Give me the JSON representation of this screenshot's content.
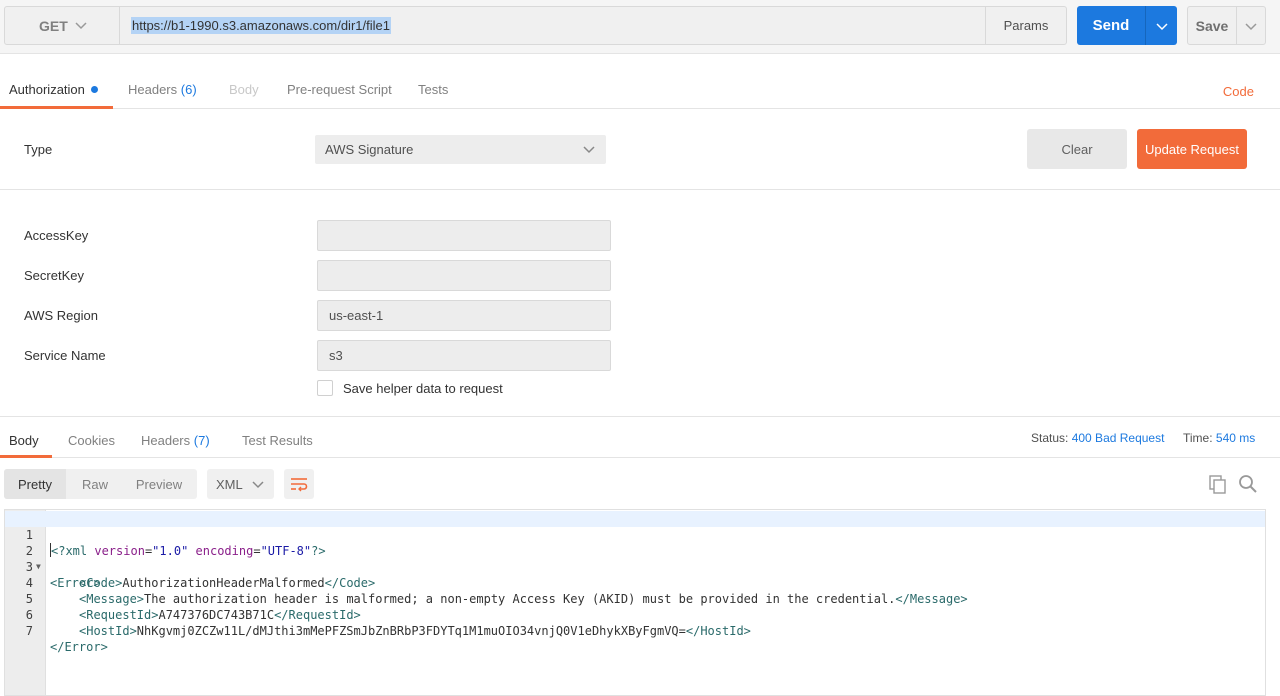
{
  "request": {
    "method": "GET",
    "url": "https://b1-1990.s3.amazonaws.com/dir1/file1",
    "params_label": "Params",
    "send_label": "Send",
    "save_label": "Save"
  },
  "request_tabs": {
    "authorization": "Authorization",
    "headers": "Headers",
    "headers_count": "(6)",
    "body": "Body",
    "prerequest": "Pre-request Script",
    "tests": "Tests",
    "code": "Code"
  },
  "auth": {
    "type_label": "Type",
    "type_value": "AWS Signature",
    "clear_label": "Clear",
    "update_label": "Update Request",
    "fields": [
      {
        "label": "AccessKey",
        "value": ""
      },
      {
        "label": "SecretKey",
        "value": ""
      },
      {
        "label": "AWS Region",
        "value": "us-east-1"
      },
      {
        "label": "Service Name",
        "value": "s3"
      }
    ],
    "save_helper_label": "Save helper data to request",
    "save_helper_checked": false
  },
  "response_tabs": {
    "body": "Body",
    "cookies": "Cookies",
    "headers": "Headers",
    "headers_count": "(7)",
    "test_results": "Test Results"
  },
  "response_status": {
    "status_label": "Status:",
    "status_value": "400 Bad Request",
    "time_label": "Time:",
    "time_value": "540 ms"
  },
  "view": {
    "pretty": "Pretty",
    "raw": "Raw",
    "preview": "Preview",
    "format": "XML"
  },
  "code": {
    "line_numbers": [
      "1",
      "2",
      "3",
      "4",
      "5",
      "6",
      "7"
    ],
    "l1_decl_open": "<?xml ",
    "l1_attr1": "version",
    "l1_val1": "\"1.0\"",
    "l1_attr2": "encoding",
    "l1_val2": "\"UTF-8\"",
    "l1_decl_close": "?>",
    "l2": "<Error>",
    "l3_open": "<Code>",
    "l3_text": "AuthorizationHeaderMalformed",
    "l3_close": "</Code>",
    "l4_open": "<Message>",
    "l4_text": "The authorization header is malformed; a non-empty Access Key (AKID) must be provided in the credential.",
    "l4_close": "</Message>",
    "l5_open": "<RequestId>",
    "l5_text": "A747376DC743B71C",
    "l5_close": "</RequestId>",
    "l6_open": "<HostId>",
    "l6_text": "NhKgvmj0ZCZw11L/dMJthi3mMePFZSmJbZnBRbP3FDYTq1M1muOIO34vnjQ0V1eDhykXByFgmVQ=",
    "l6_close": "</HostId>",
    "l7": "</Error>"
  },
  "colors": {
    "accent_blue": "#1c79df",
    "accent_orange": "#f26b3a"
  }
}
